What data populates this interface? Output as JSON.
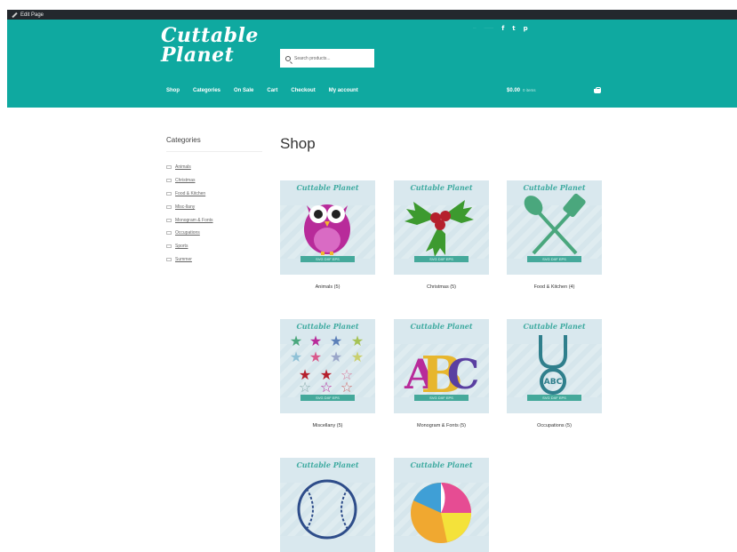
{
  "admin_bar": {
    "edit_label": "Edit Page"
  },
  "header": {
    "logo_line1": "Cuttable",
    "logo_line2": "Planet",
    "search_placeholder": "Search products...",
    "social_icons": [
      "facebook-icon",
      "twitter-icon",
      "pinterest-icon"
    ],
    "social_glyphs": [
      "f",
      "t",
      "p"
    ]
  },
  "nav": {
    "items": [
      "Shop",
      "Categories",
      "On Sale",
      "Cart",
      "Checkout",
      "My account"
    ]
  },
  "cart": {
    "amount": "$0.00",
    "items": "0 items"
  },
  "sidebar": {
    "title": "Categories",
    "items": [
      "Animals",
      "Christmas",
      "Food & Kitchen",
      "Misc-llany",
      "Monogram & Fonts",
      "Occupations",
      "Sports",
      "Summer"
    ]
  },
  "main": {
    "title": "Shop",
    "thumb_brand": "Cuttable Planet",
    "thumb_ribbon": "SVG  DXF  EPS",
    "products": [
      {
        "caption": "Animals (5)",
        "art": "owl"
      },
      {
        "caption": "Christmas (5)",
        "art": "holly"
      },
      {
        "caption": "Food & Kitchen (4)",
        "art": "utensils"
      },
      {
        "caption": "Miscellany (5)",
        "art": "stars"
      },
      {
        "caption": "Monogram & Fonts (5)",
        "art": "monogram"
      },
      {
        "caption": "Occupations (5)",
        "art": "stethoscope"
      },
      {
        "caption": "",
        "art": "baseball"
      },
      {
        "caption": "",
        "art": "beachball"
      }
    ]
  },
  "colors": {
    "header_teal": "#0fa9a0",
    "admin_dark": "#23282d",
    "ribbon_teal": "#45a99b"
  }
}
